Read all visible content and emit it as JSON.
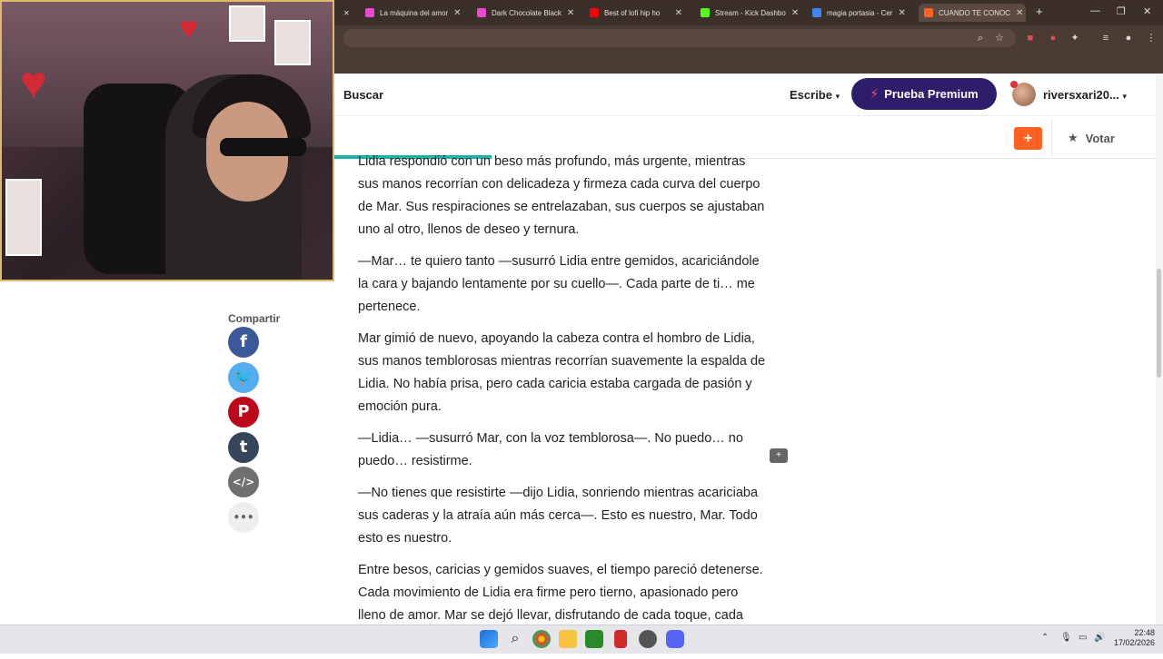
{
  "browser": {
    "tabs": [
      {
        "title": "La máquina del amor",
        "color": "#e94ad0"
      },
      {
        "title": "Dark Chocolate Black",
        "color": "#e94ad0"
      },
      {
        "title": "Best of lofi hip ho",
        "color": "#ff0000"
      },
      {
        "title": "Stream - Kick Dashbo",
        "color": "#53fc18"
      },
      {
        "title": "magia portasia - Cer",
        "color": "#4285f4"
      },
      {
        "title": "CUANDO TE CONOC",
        "color": "#ff6122"
      }
    ],
    "new_tab": "+",
    "window_controls": [
      "—",
      "❐",
      "✕"
    ]
  },
  "nav": {
    "search": "Buscar",
    "write": "Escribe",
    "premium": "Prueba Premium",
    "username": "riversxari20...",
    "add": "+",
    "vote": "Votar"
  },
  "share": {
    "label": "Compartir",
    "buttons": [
      {
        "name": "facebook",
        "glyph": "f",
        "color": "#3b5998"
      },
      {
        "name": "twitter",
        "glyph": "🐦",
        "color": "#55acee"
      },
      {
        "name": "pinterest",
        "glyph": "P",
        "color": "#bd081c"
      },
      {
        "name": "tumblr",
        "glyph": "t",
        "color": "#35465c"
      },
      {
        "name": "embed",
        "glyph": "</>",
        "color": "#6f6f6f"
      },
      {
        "name": "more",
        "glyph": "•••",
        "color": "#eeeeee"
      }
    ]
  },
  "story": {
    "paragraphs": [
      "Lidia respondió con un beso más profundo, más urgente, mientras sus manos recorrían con delicadeza y firmeza cada curva del cuerpo de Mar. Sus respiraciones se entrelazaban, sus cuerpos se ajustaban uno al otro, llenos de deseo y ternura.",
      "—Mar… te quiero tanto —susurró Lidia entre gemidos, acariciándole la cara y bajando lentamente por su cuello—. Cada parte de ti… me pertenece.",
      "Mar gimió de nuevo, apoyando la cabeza contra el hombro de Lidia, sus manos temblorosas mientras recorrían suavemente la espalda de Lidia. No había prisa, pero cada caricia estaba cargada de pasión y emoción pura.",
      "—Lidia… —susurró Mar, con la voz temblorosa—. No puedo… no puedo… resistirme.",
      "—No tienes que resistirte —dijo Lidia, sonriendo mientras acariciaba sus caderas y la atraía aún más cerca—. Esto es nuestro, Mar. Todo esto es nuestro.",
      "Entre besos, caricias y gemidos suaves, el tiempo pareció detenerse. Cada movimiento de Lidia era firme pero tierno, apasionado pero lleno de amor. Mar se dejó llevar, disfrutando de cada toque, cada roce, cada"
    ]
  },
  "progress": 0.19,
  "taskbar": {
    "time": "22:48",
    "date": "17/02/2026"
  }
}
